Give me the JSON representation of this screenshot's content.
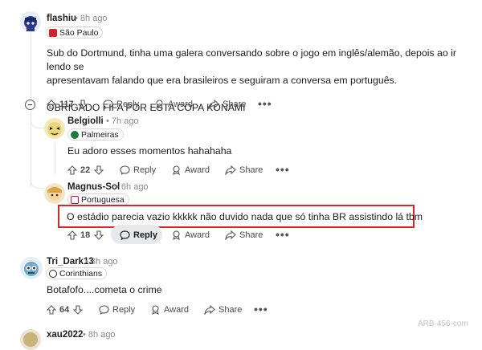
{
  "comments": [
    {
      "username": "flashiu",
      "time": "• 8h ago",
      "flair": "São Paulo",
      "text_lines": [
        "Sub do Dortmund, tinha uma galera conversando sobre o jogo em inglês/alemão, depois ao ir lendo se",
        "apresentavam falando que era brasileiros e seguiram a conversa em português.",
        "",
        "OBRIGADO FIFA POR ESTA COPA KONAMI"
      ],
      "votes": "117",
      "reply": "Reply",
      "award": "Award",
      "share": "Share"
    },
    {
      "username": "Belgiolli",
      "time": "• 7h ago",
      "flair": "Palmeiras",
      "text": "Eu adoro esses momentos hahahaha",
      "votes": "22",
      "reply": "Reply",
      "award": "Award",
      "share": "Share"
    },
    {
      "username": "Magnus-Sol",
      "time": "• 6h ago",
      "flair": "Portuguesa",
      "text": "O estádio parecia vazio kkkkk não duvido nada que só tinha BR assistindo lá tbm",
      "votes": "18",
      "reply": "Reply",
      "award": "Award",
      "share": "Share"
    },
    {
      "username": "Tri_Dark13",
      "time": "• 8h ago",
      "flair": "Corinthians",
      "text": "Botafofo....cometa o crime",
      "votes": "64",
      "reply": "Reply",
      "award": "Award",
      "share": "Share"
    },
    {
      "username": "xau2022",
      "time": "• 8h ago"
    }
  ],
  "more_label": "•••",
  "watermark": "ARB·456·com",
  "colors": {
    "highlight": "#e02424",
    "saopaulo": "#d61f26",
    "palmeiras": "#1e7a3a",
    "portuguesa": "#c8102e",
    "corinthians": "#222222"
  }
}
